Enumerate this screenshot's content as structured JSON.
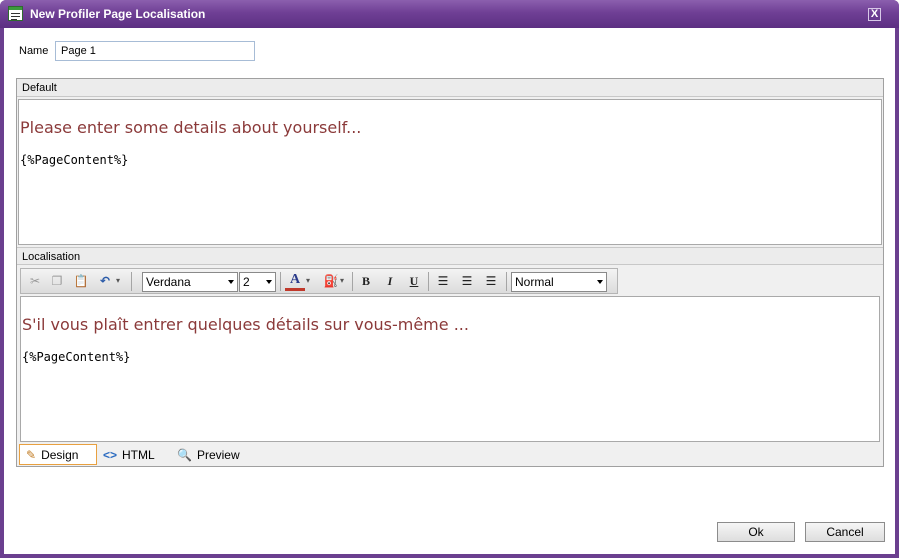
{
  "window": {
    "title": "New Profiler Page Localisation",
    "close_glyph": "X",
    "icon": "form-window-icon"
  },
  "name_field": {
    "label": "Name",
    "value": "Page 1"
  },
  "default_section": {
    "header": "Default",
    "heading_text": "Please enter some details about yourself...",
    "body_text": "{%PageContent%}"
  },
  "localisation_section": {
    "header": "Localisation",
    "heading_text": "S'il vous plaît entrer quelques détails sur vous-même ...",
    "body_text": "{%PageContent%}"
  },
  "toolbar": {
    "font_name": "Verdana",
    "font_size": "2",
    "paragraph_style": "Normal",
    "bold": "B",
    "italic": "I",
    "underline": "U",
    "font_color_glyph": "A",
    "font_color": "#c0392b",
    "icons": [
      "cut-icon",
      "copy-icon",
      "paste-icon",
      "undo-icon",
      "font-color-icon",
      "highlight-color-icon",
      "bold-icon",
      "italic-icon",
      "underline-icon",
      "align-left-icon",
      "align-center-icon",
      "align-right-icon"
    ]
  },
  "mode_tabs": [
    {
      "label": "Design",
      "icon": "pencil-icon",
      "active": true
    },
    {
      "label": "HTML",
      "icon": "code-brackets-icon",
      "active": false
    },
    {
      "label": "Preview",
      "icon": "magnifier-icon",
      "active": false
    }
  ],
  "buttons": {
    "ok": "Ok",
    "cancel": "Cancel"
  },
  "colors": {
    "title_bar": "#6f3f95",
    "heading_text": "#8b3a3a",
    "active_tab_border": "#e8a040"
  }
}
